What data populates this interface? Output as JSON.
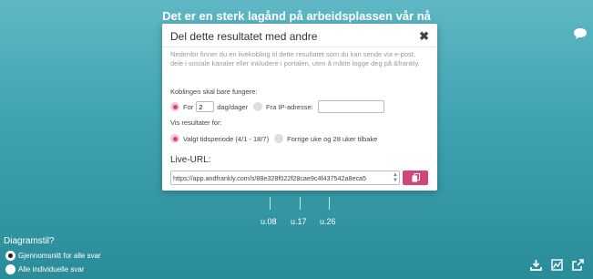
{
  "page": {
    "title": "Det er en sterk lagånd på arbeidsplassen vår nå",
    "axis_labels": [
      "u.08",
      "u.17",
      "u.26"
    ]
  },
  "diagram": {
    "title": "Diagramstil?",
    "options": [
      {
        "label": "Gjennomsnitt for alle svar",
        "selected": true
      },
      {
        "label": "Alle individuelle svar",
        "selected": false
      }
    ]
  },
  "modal": {
    "title": "Del dette resultatet med andre",
    "intro": "Nedenfor finner du en livekobling til dette resultatet som du kan sende via e-post, dele i sosiale kanaler eller inkludere i portalen, uten å måtte logge deg på &frankly.",
    "link_label": "Koblingen skal bare fungere:",
    "for_label": "For",
    "days_value": "2",
    "days_unit": "dag/dager",
    "ip_label": "Fra IP-adresse:",
    "ip_value": "",
    "results_label": "Vis resultater for:",
    "period_option": "Valgt tidsperiode (4/1 - 18/7)",
    "previous_option": "Forrige uke og 28 uker tilbake",
    "live_url_label": "Live-URL:",
    "live_url": "https://app.andfrankly.com/s/88e328f022f28cae9c4f437542a8eca5"
  },
  "colors": {
    "accent": "#d2477a",
    "background_top": "#5fb7c4",
    "background_bottom": "#2b8c99"
  },
  "icons": {
    "close": "close-icon",
    "chat": "chat-icon",
    "copy": "copy-icon",
    "download": "download-icon",
    "chart": "chart-icon",
    "share": "share-icon"
  }
}
